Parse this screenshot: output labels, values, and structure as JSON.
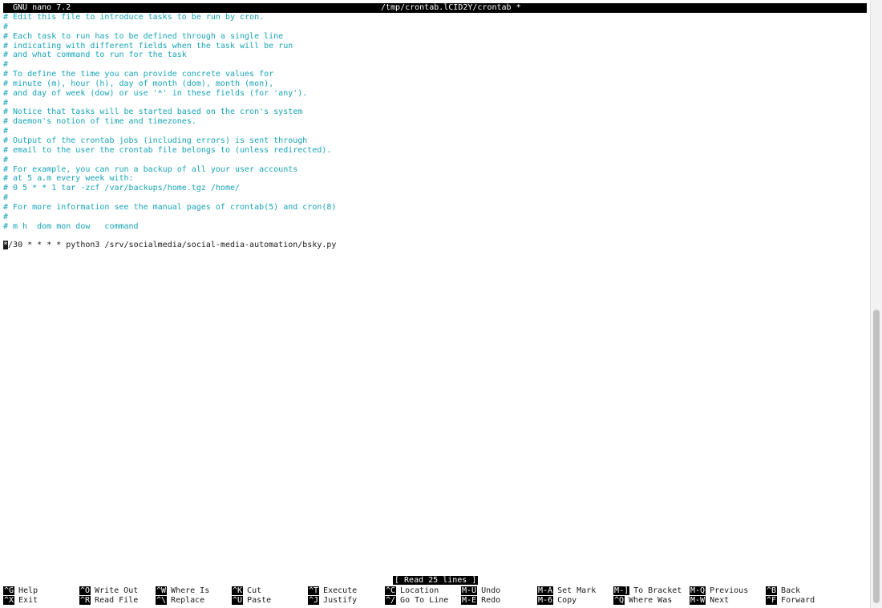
{
  "title_bar": {
    "app_name": "GNU nano 7.2",
    "file_name": "/tmp/crontab.lCID2Y/crontab *"
  },
  "editor": {
    "comment_lines": [
      "# Edit this file to introduce tasks to be run by cron.",
      "#",
      "# Each task to run has to be defined through a single line",
      "# indicating with different fields when the task will be run",
      "# and what command to run for the task",
      "#",
      "# To define the time you can provide concrete values for",
      "# minute (m), hour (h), day of month (dom), month (mon),",
      "# and day of week (dow) or use '*' in these fields (for 'any').",
      "#",
      "# Notice that tasks will be started based on the cron's system",
      "# daemon's notion of time and timezones.",
      "#",
      "# Output of the crontab jobs (including errors) is sent through",
      "# email to the user the crontab file belongs to (unless redirected).",
      "#",
      "# For example, you can run a backup of all your user accounts",
      "# at 5 a.m every week with:",
      "# 0 5 * * 1 tar -zcf /var/backups/home.tgz /home/",
      "#",
      "# For more information see the manual pages of crontab(5) and cron(8)",
      "#",
      "# m h  dom mon dow   command"
    ],
    "cron_line_cursor_char": "*",
    "cron_line_rest": "/30 * * * * python3 /srv/socialmedia/social-media-automation/bsky.py"
  },
  "status_message": "[ Read 25 lines ]",
  "shortcuts": {
    "row1": [
      {
        "key": "^G",
        "label": "Help"
      },
      {
        "key": "^O",
        "label": "Write Out"
      },
      {
        "key": "^W",
        "label": "Where Is"
      },
      {
        "key": "^K",
        "label": "Cut"
      },
      {
        "key": "^T",
        "label": "Execute"
      },
      {
        "key": "^C",
        "label": "Location"
      },
      {
        "key": "M-U",
        "label": "Undo"
      },
      {
        "key": "M-A",
        "label": "Set Mark"
      },
      {
        "key": "M-]",
        "label": "To Bracket"
      },
      {
        "key": "M-Q",
        "label": "Previous"
      },
      {
        "key": "^B",
        "label": "Back"
      }
    ],
    "row2": [
      {
        "key": "^X",
        "label": "Exit"
      },
      {
        "key": "^R",
        "label": "Read File"
      },
      {
        "key": "^\\",
        "label": "Replace"
      },
      {
        "key": "^U",
        "label": "Paste"
      },
      {
        "key": "^J",
        "label": "Justify"
      },
      {
        "key": "^/",
        "label": "Go To Line"
      },
      {
        "key": "M-E",
        "label": "Redo"
      },
      {
        "key": "M-6",
        "label": "Copy"
      },
      {
        "key": "^Q",
        "label": "Where Was"
      },
      {
        "key": "M-W",
        "label": "Next"
      },
      {
        "key": "^F",
        "label": "Forward"
      }
    ]
  },
  "colors": {
    "comment": "#17a4b8",
    "text": "#1a1a1a",
    "bar_bg": "#000000",
    "bar_fg": "#ffffff"
  }
}
